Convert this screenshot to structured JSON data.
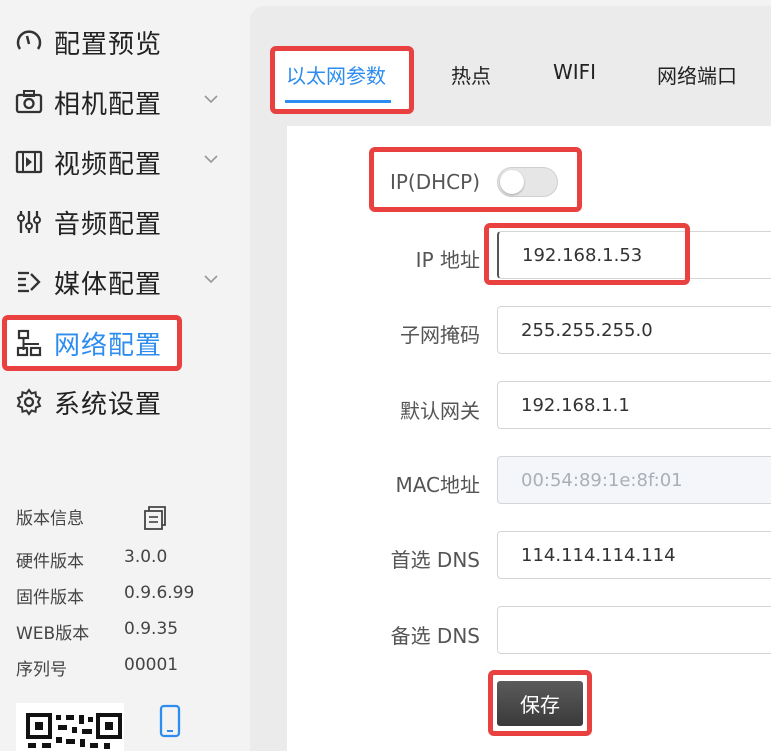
{
  "sidebar": {
    "items": [
      {
        "label": "配置预览",
        "icon": "gauge-icon"
      },
      {
        "label": "相机配置",
        "icon": "camera-icon"
      },
      {
        "label": "视频配置",
        "icon": "film-icon"
      },
      {
        "label": "音频配置",
        "icon": "sliders-icon"
      },
      {
        "label": "媒体配置",
        "icon": "media-icon"
      },
      {
        "label": "网络配置",
        "icon": "network-icon"
      },
      {
        "label": "系统设置",
        "icon": "gear-icon"
      }
    ],
    "version_info": {
      "title": "版本信息",
      "rows": [
        {
          "label": "硬件版本",
          "value": "3.0.0"
        },
        {
          "label": "固件版本",
          "value": "0.9.6.99"
        },
        {
          "label": "WEB版本",
          "value": "0.9.35"
        },
        {
          "label": "序列号",
          "value": "00001"
        }
      ]
    }
  },
  "tabs": [
    {
      "label": "以太网参数"
    },
    {
      "label": "热点"
    },
    {
      "label": "WIFI"
    },
    {
      "label": "网络端口"
    }
  ],
  "form": {
    "dhcp_label": "IP(DHCP)",
    "fields": [
      {
        "label": "IP 地址",
        "value": "192.168.1.53"
      },
      {
        "label": "子网掩码",
        "value": "255.255.255.0"
      },
      {
        "label": "默认网关",
        "value": "192.168.1.1"
      },
      {
        "label": "MAC地址",
        "value": "00:54:89:1e:8f:01"
      },
      {
        "label": "首选 DNS",
        "value": "114.114.114.114"
      },
      {
        "label": "备选 DNS",
        "value": ""
      }
    ],
    "save_label": "保存"
  },
  "colors": {
    "accent": "#2d8cf0",
    "highlight": "#e8413f"
  }
}
